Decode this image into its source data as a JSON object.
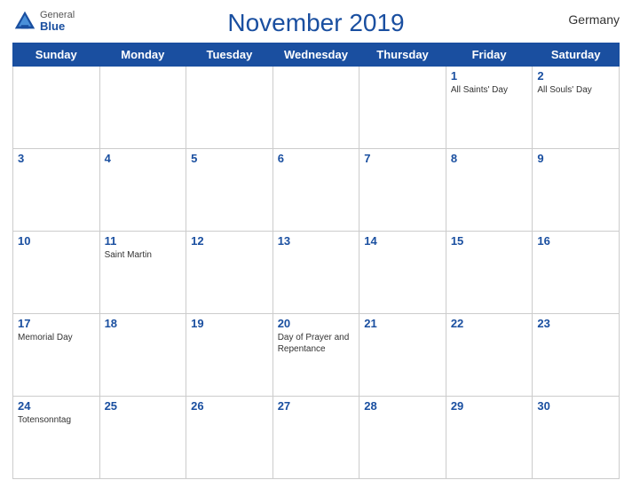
{
  "header": {
    "title": "November 2019",
    "country": "Germany",
    "logo": {
      "general": "General",
      "blue": "Blue"
    }
  },
  "weekdays": [
    "Sunday",
    "Monday",
    "Tuesday",
    "Wednesday",
    "Thursday",
    "Friday",
    "Saturday"
  ],
  "weeks": [
    [
      {
        "day": null,
        "event": null
      },
      {
        "day": null,
        "event": null
      },
      {
        "day": null,
        "event": null
      },
      {
        "day": null,
        "event": null
      },
      {
        "day": null,
        "event": null
      },
      {
        "day": "1",
        "event": "All Saints' Day"
      },
      {
        "day": "2",
        "event": "All Souls' Day"
      }
    ],
    [
      {
        "day": "3",
        "event": null
      },
      {
        "day": "4",
        "event": null
      },
      {
        "day": "5",
        "event": null
      },
      {
        "day": "6",
        "event": null
      },
      {
        "day": "7",
        "event": null
      },
      {
        "day": "8",
        "event": null
      },
      {
        "day": "9",
        "event": null
      }
    ],
    [
      {
        "day": "10",
        "event": null
      },
      {
        "day": "11",
        "event": "Saint Martin"
      },
      {
        "day": "12",
        "event": null
      },
      {
        "day": "13",
        "event": null
      },
      {
        "day": "14",
        "event": null
      },
      {
        "day": "15",
        "event": null
      },
      {
        "day": "16",
        "event": null
      }
    ],
    [
      {
        "day": "17",
        "event": "Memorial Day"
      },
      {
        "day": "18",
        "event": null
      },
      {
        "day": "19",
        "event": null
      },
      {
        "day": "20",
        "event": "Day of Prayer and Repentance"
      },
      {
        "day": "21",
        "event": null
      },
      {
        "day": "22",
        "event": null
      },
      {
        "day": "23",
        "event": null
      }
    ],
    [
      {
        "day": "24",
        "event": "Totensonntag"
      },
      {
        "day": "25",
        "event": null
      },
      {
        "day": "26",
        "event": null
      },
      {
        "day": "27",
        "event": null
      },
      {
        "day": "28",
        "event": null
      },
      {
        "day": "29",
        "event": null
      },
      {
        "day": "30",
        "event": null
      }
    ]
  ]
}
